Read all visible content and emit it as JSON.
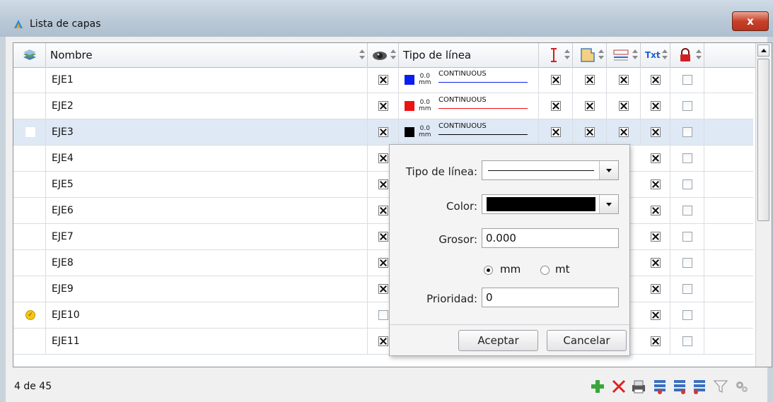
{
  "window": {
    "title": "Lista de capas",
    "close_label": "x"
  },
  "grid": {
    "headers": {
      "name": "Nombre",
      "linetype": "Tipo de línea",
      "text": "Txt"
    },
    "rows": [
      {
        "name": "EJE1",
        "visible": true,
        "color": "#0a1ef0",
        "width": "0.0",
        "unit": "mm",
        "linetype": "CONTINUOUS",
        "c1": true,
        "c2": true,
        "c3": true,
        "c4": true,
        "lock": false,
        "status": ""
      },
      {
        "name": "EJE2",
        "visible": true,
        "color": "#ee1111",
        "width": "0.0",
        "unit": "mm",
        "linetype": "CONTINUOUS",
        "c1": true,
        "c2": true,
        "c3": true,
        "c4": true,
        "lock": false,
        "status": ""
      },
      {
        "name": "EJE3",
        "visible": true,
        "color": "#000000",
        "width": "0.0",
        "unit": "mm",
        "linetype": "CONTINUOUS",
        "c1": true,
        "c2": true,
        "c3": true,
        "c4": true,
        "lock": false,
        "status": "selected"
      },
      {
        "name": "EJE4",
        "visible": true,
        "c4": true,
        "lock": false,
        "status": ""
      },
      {
        "name": "EJE5",
        "visible": true,
        "c4": true,
        "lock": false,
        "status": ""
      },
      {
        "name": "EJE6",
        "visible": true,
        "c4": true,
        "lock": false,
        "status": ""
      },
      {
        "name": "EJE7",
        "visible": true,
        "c4": true,
        "lock": false,
        "status": ""
      },
      {
        "name": "EJE8",
        "visible": true,
        "c4": true,
        "lock": false,
        "status": ""
      },
      {
        "name": "EJE9",
        "visible": true,
        "c4": true,
        "lock": false,
        "status": ""
      },
      {
        "name": "EJE10",
        "visible": false,
        "c4": true,
        "lock": false,
        "status": "current"
      },
      {
        "name": "EJE11",
        "visible": true,
        "c4": true,
        "lock": false,
        "status": ""
      }
    ]
  },
  "popup": {
    "linetype_label": "Tipo de línea:",
    "color_label": "Color:",
    "color_value": "#000000",
    "width_label": "Grosor:",
    "width_value": "0.000",
    "unit_mm": "mm",
    "unit_mt": "mt",
    "unit_selected": "mm",
    "priority_label": "Prioridad:",
    "priority_value": "0",
    "accept": "Aceptar",
    "cancel": "Cancelar"
  },
  "footer": {
    "record_count": "4 de 45",
    "icons": [
      "add-layer-icon",
      "delete-icon",
      "print-icon",
      "layers-import-icon",
      "layers-export-icon",
      "layers-merge-icon",
      "filter-icon",
      "settings-icon"
    ]
  }
}
